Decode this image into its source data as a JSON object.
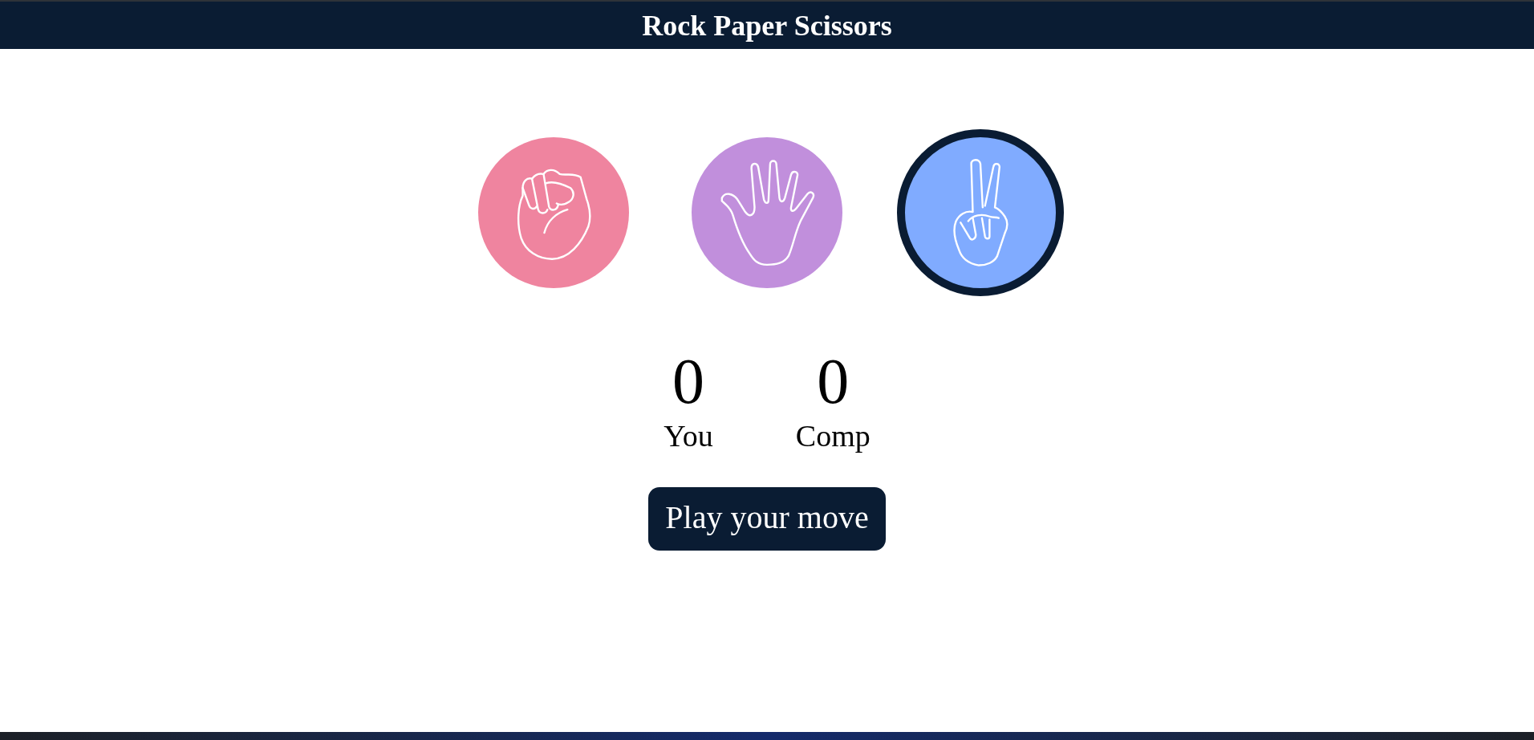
{
  "header": {
    "title": "Rock Paper Scissors"
  },
  "choices": [
    {
      "kind": "rock",
      "color": "#ef849f",
      "selected": false
    },
    {
      "kind": "paper",
      "color": "#c18fdc",
      "selected": false
    },
    {
      "kind": "scissors",
      "color": "#80abff",
      "selected": true
    }
  ],
  "scores": [
    {
      "value": "0",
      "label": "You"
    },
    {
      "value": "0",
      "label": "Comp"
    }
  ],
  "play_button": {
    "label": "Play your move"
  }
}
